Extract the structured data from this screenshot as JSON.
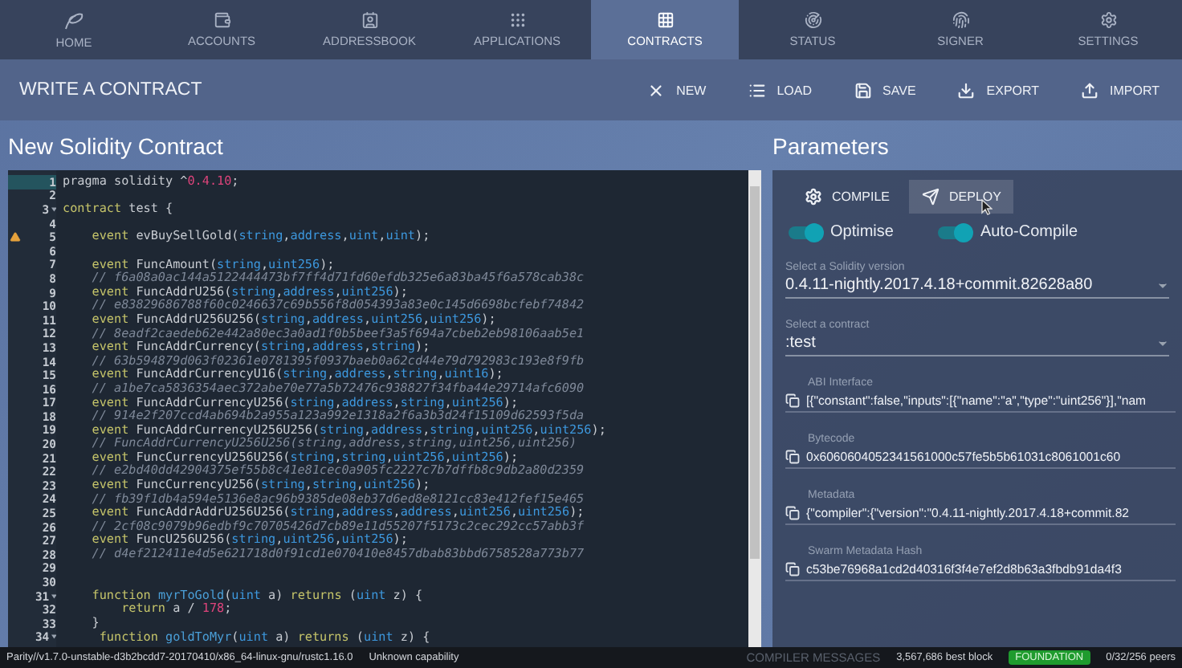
{
  "nav": {
    "tabs": [
      {
        "label": "HOME",
        "selected": false
      },
      {
        "label": "ACCOUNTS",
        "selected": false
      },
      {
        "label": "ADDRESSBOOK",
        "selected": false
      },
      {
        "label": "APPLICATIONS",
        "selected": false
      },
      {
        "label": "CONTRACTS",
        "selected": true
      },
      {
        "label": "STATUS",
        "selected": false
      },
      {
        "label": "SIGNER",
        "selected": false
      },
      {
        "label": "SETTINGS",
        "selected": false
      }
    ]
  },
  "toolbar": {
    "title": "WRITE A CONTRACT",
    "actions": [
      "NEW",
      "LOAD",
      "SAVE",
      "EXPORT",
      "IMPORT"
    ]
  },
  "editor": {
    "title": "New Solidity Contract",
    "lines": [
      {
        "number": "1",
        "current": true,
        "fold": false,
        "warning": false,
        "tokens": [
          {
            "kind": "plain",
            "text": "pragma solidity ^"
          },
          {
            "kind": "number",
            "text": "0.4.10"
          },
          {
            "kind": "plain",
            "text": ";"
          }
        ]
      },
      {
        "number": "2",
        "current": false,
        "fold": false,
        "warning": false
      },
      {
        "number": "3",
        "current": false,
        "fold": true,
        "warning": false,
        "tokens": [
          {
            "kind": "keyword",
            "text": "contract"
          },
          {
            "kind": "plain",
            "text": " test {"
          }
        ]
      },
      {
        "number": "4",
        "current": false,
        "fold": false,
        "warning": false
      },
      {
        "number": "5",
        "current": false,
        "fold": false,
        "warning": true,
        "tokens": [
          {
            "kind": "keyword",
            "text": "    event"
          },
          {
            "kind": "plain",
            "text": " evBuySellGold("
          },
          {
            "kind": "type",
            "text": "string"
          },
          {
            "kind": "plain",
            "text": ","
          },
          {
            "kind": "type",
            "text": "address"
          },
          {
            "kind": "plain",
            "text": ","
          },
          {
            "kind": "type",
            "text": "uint"
          },
          {
            "kind": "plain",
            "text": ","
          },
          {
            "kind": "type",
            "text": "uint"
          },
          {
            "kind": "plain",
            "text": ");"
          }
        ]
      },
      {
        "number": "6",
        "current": false,
        "fold": false,
        "warning": false
      },
      {
        "number": "7",
        "current": false,
        "fold": false,
        "warning": false,
        "tokens": [
          {
            "kind": "keyword",
            "text": "    event"
          },
          {
            "kind": "plain",
            "text": " FuncAmount("
          },
          {
            "kind": "type",
            "text": "string"
          },
          {
            "kind": "plain",
            "text": ","
          },
          {
            "kind": "type",
            "text": "uint256"
          },
          {
            "kind": "plain",
            "text": ");"
          }
        ]
      },
      {
        "number": "8",
        "current": false,
        "fold": false,
        "warning": false,
        "tokens": [
          {
            "kind": "comment",
            "text": "    // f6a08a0ac144a5122444473bf7ff4d71fd60efdb325e6a83ba45f6a578cab38c"
          }
        ]
      },
      {
        "number": "9",
        "current": false,
        "fold": false,
        "warning": false,
        "tokens": [
          {
            "kind": "keyword",
            "text": "    event"
          },
          {
            "kind": "plain",
            "text": " FuncAddrU256("
          },
          {
            "kind": "type",
            "text": "string"
          },
          {
            "kind": "plain",
            "text": ","
          },
          {
            "kind": "type",
            "text": "address"
          },
          {
            "kind": "plain",
            "text": ","
          },
          {
            "kind": "type",
            "text": "uint256"
          },
          {
            "kind": "plain",
            "text": ");"
          }
        ]
      },
      {
        "number": "10",
        "current": false,
        "fold": false,
        "warning": false,
        "tokens": [
          {
            "kind": "comment",
            "text": "    // e83829686788f60c0246637c69b556f8d054393a83e0c145d6698bcfebf74842"
          }
        ]
      },
      {
        "number": "11",
        "current": false,
        "fold": false,
        "warning": false,
        "tokens": [
          {
            "kind": "keyword",
            "text": "    event"
          },
          {
            "kind": "plain",
            "text": " FuncAddrU256U256("
          },
          {
            "kind": "type",
            "text": "string"
          },
          {
            "kind": "plain",
            "text": ","
          },
          {
            "kind": "type",
            "text": "address"
          },
          {
            "kind": "plain",
            "text": ","
          },
          {
            "kind": "type",
            "text": "uint256"
          },
          {
            "kind": "plain",
            "text": ","
          },
          {
            "kind": "type",
            "text": "uint256"
          },
          {
            "kind": "plain",
            "text": ");"
          }
        ]
      },
      {
        "number": "12",
        "current": false,
        "fold": false,
        "warning": false,
        "tokens": [
          {
            "kind": "comment",
            "text": "    // 8eadf2caedeb62e442a80ec3a0ad1f0b5beef3a5f694a7cbeb2eb98106aab5e1"
          }
        ]
      },
      {
        "number": "13",
        "current": false,
        "fold": false,
        "warning": false,
        "tokens": [
          {
            "kind": "keyword",
            "text": "    event"
          },
          {
            "kind": "plain",
            "text": " FuncAddrCurrency("
          },
          {
            "kind": "type",
            "text": "string"
          },
          {
            "kind": "plain",
            "text": ","
          },
          {
            "kind": "type",
            "text": "address"
          },
          {
            "kind": "plain",
            "text": ","
          },
          {
            "kind": "type",
            "text": "string"
          },
          {
            "kind": "plain",
            "text": ");"
          }
        ]
      },
      {
        "number": "14",
        "current": false,
        "fold": false,
        "warning": false,
        "tokens": [
          {
            "kind": "comment",
            "text": "    // 63b594879d063f02361e0781395f0937baeb0a62cd44e79d792983c193e8f9fb"
          }
        ]
      },
      {
        "number": "15",
        "current": false,
        "fold": false,
        "warning": false,
        "tokens": [
          {
            "kind": "keyword",
            "text": "    event"
          },
          {
            "kind": "plain",
            "text": " FuncAddrCurrencyU16("
          },
          {
            "kind": "type",
            "text": "string"
          },
          {
            "kind": "plain",
            "text": ","
          },
          {
            "kind": "type",
            "text": "address"
          },
          {
            "kind": "plain",
            "text": ","
          },
          {
            "kind": "type",
            "text": "string"
          },
          {
            "kind": "plain",
            "text": ","
          },
          {
            "kind": "type",
            "text": "uint16"
          },
          {
            "kind": "plain",
            "text": ");"
          }
        ]
      },
      {
        "number": "16",
        "current": false,
        "fold": false,
        "warning": false,
        "tokens": [
          {
            "kind": "comment",
            "text": "    // a1be7ca5836354aec372abe70e77a5b72476c938827f34fba44e29714afc6090"
          }
        ]
      },
      {
        "number": "17",
        "current": false,
        "fold": false,
        "warning": false,
        "tokens": [
          {
            "kind": "keyword",
            "text": "    event"
          },
          {
            "kind": "plain",
            "text": " FuncAddrCurrencyU256("
          },
          {
            "kind": "type",
            "text": "string"
          },
          {
            "kind": "plain",
            "text": ","
          },
          {
            "kind": "type",
            "text": "address"
          },
          {
            "kind": "plain",
            "text": ","
          },
          {
            "kind": "type",
            "text": "string"
          },
          {
            "kind": "plain",
            "text": ","
          },
          {
            "kind": "type",
            "text": "uint256"
          },
          {
            "kind": "plain",
            "text": ");"
          }
        ]
      },
      {
        "number": "18",
        "current": false,
        "fold": false,
        "warning": false,
        "tokens": [
          {
            "kind": "comment",
            "text": "    // 914e2f207ccd4ab694b2a955a123a992e1318a2f6a3b3d24f15109d62593f5da"
          }
        ]
      },
      {
        "number": "19",
        "current": false,
        "fold": false,
        "warning": false,
        "tokens": [
          {
            "kind": "keyword",
            "text": "    event"
          },
          {
            "kind": "plain",
            "text": " FuncAddrCurrencyU256U256("
          },
          {
            "kind": "type",
            "text": "string"
          },
          {
            "kind": "plain",
            "text": ","
          },
          {
            "kind": "type",
            "text": "address"
          },
          {
            "kind": "plain",
            "text": ","
          },
          {
            "kind": "type",
            "text": "string"
          },
          {
            "kind": "plain",
            "text": ","
          },
          {
            "kind": "type",
            "text": "uint256"
          },
          {
            "kind": "plain",
            "text": ","
          },
          {
            "kind": "type",
            "text": "uint256"
          },
          {
            "kind": "plain",
            "text": ");"
          }
        ]
      },
      {
        "number": "20",
        "current": false,
        "fold": false,
        "warning": false,
        "tokens": [
          {
            "kind": "comment",
            "text": "    // FuncAddrCurrencyU256U256(string,address,string,uint256,uint256)"
          }
        ]
      },
      {
        "number": "21",
        "current": false,
        "fold": false,
        "warning": false,
        "tokens": [
          {
            "kind": "keyword",
            "text": "    event"
          },
          {
            "kind": "plain",
            "text": " FuncCurrencyU256U256("
          },
          {
            "kind": "type",
            "text": "string"
          },
          {
            "kind": "plain",
            "text": ","
          },
          {
            "kind": "type",
            "text": "string"
          },
          {
            "kind": "plain",
            "text": ","
          },
          {
            "kind": "type",
            "text": "uint256"
          },
          {
            "kind": "plain",
            "text": ","
          },
          {
            "kind": "type",
            "text": "uint256"
          },
          {
            "kind": "plain",
            "text": ");"
          }
        ]
      },
      {
        "number": "22",
        "current": false,
        "fold": false,
        "warning": false,
        "tokens": [
          {
            "kind": "comment",
            "text": "    // e2bd40dd42904375ef55b8c41e81cec0a905fc2227c7b7dffb8c9db2a80d2359"
          }
        ]
      },
      {
        "number": "23",
        "current": false,
        "fold": false,
        "warning": false,
        "tokens": [
          {
            "kind": "keyword",
            "text": "    event"
          },
          {
            "kind": "plain",
            "text": " FuncCurrencyU256("
          },
          {
            "kind": "type",
            "text": "string"
          },
          {
            "kind": "plain",
            "text": ","
          },
          {
            "kind": "type",
            "text": "string"
          },
          {
            "kind": "plain",
            "text": ","
          },
          {
            "kind": "type",
            "text": "uint256"
          },
          {
            "kind": "plain",
            "text": ");"
          }
        ]
      },
      {
        "number": "24",
        "current": false,
        "fold": false,
        "warning": false,
        "tokens": [
          {
            "kind": "comment",
            "text": "    // fb39f1db4a594e5136e8ac96b9385de08eb37d6ed8e8121cc83e412fef15e465"
          }
        ]
      },
      {
        "number": "25",
        "current": false,
        "fold": false,
        "warning": false,
        "tokens": [
          {
            "kind": "keyword",
            "text": "    event"
          },
          {
            "kind": "plain",
            "text": " FuncAddrAddrU256U256("
          },
          {
            "kind": "type",
            "text": "string"
          },
          {
            "kind": "plain",
            "text": ","
          },
          {
            "kind": "type",
            "text": "address"
          },
          {
            "kind": "plain",
            "text": ","
          },
          {
            "kind": "type",
            "text": "address"
          },
          {
            "kind": "plain",
            "text": ","
          },
          {
            "kind": "type",
            "text": "uint256"
          },
          {
            "kind": "plain",
            "text": ","
          },
          {
            "kind": "type",
            "text": "uint256"
          },
          {
            "kind": "plain",
            "text": ");"
          }
        ]
      },
      {
        "number": "26",
        "current": false,
        "fold": false,
        "warning": false,
        "tokens": [
          {
            "kind": "comment",
            "text": "    // 2cf08c9079b96edbf9c70705426d7cb89e11d55207f5173c2cec292cc57abb3f"
          }
        ]
      },
      {
        "number": "27",
        "current": false,
        "fold": false,
        "warning": false,
        "tokens": [
          {
            "kind": "keyword",
            "text": "    event"
          },
          {
            "kind": "plain",
            "text": " FuncU256U256("
          },
          {
            "kind": "type",
            "text": "string"
          },
          {
            "kind": "plain",
            "text": ","
          },
          {
            "kind": "type",
            "text": "uint256"
          },
          {
            "kind": "plain",
            "text": ","
          },
          {
            "kind": "type",
            "text": "uint256"
          },
          {
            "kind": "plain",
            "text": ");"
          }
        ]
      },
      {
        "number": "28",
        "current": false,
        "fold": false,
        "warning": false,
        "tokens": [
          {
            "kind": "comment",
            "text": "    // d4ef212411e4d5e621718d0f91cd1e070410e8457dbab83bbd6758528a773b77"
          }
        ]
      },
      {
        "number": "29",
        "current": false,
        "fold": false,
        "warning": false
      },
      {
        "number": "30",
        "current": false,
        "fold": false,
        "warning": false
      },
      {
        "number": "31",
        "current": false,
        "fold": true,
        "warning": false,
        "tokens": [
          {
            "kind": "keyword",
            "text": "    function"
          },
          {
            "kind": "name",
            "text": " myrToGold"
          },
          {
            "kind": "plain",
            "text": "("
          },
          {
            "kind": "type",
            "text": "uint"
          },
          {
            "kind": "plain",
            "text": " a) "
          },
          {
            "kind": "keyword",
            "text": "returns"
          },
          {
            "kind": "plain",
            "text": " ("
          },
          {
            "kind": "type",
            "text": "uint"
          },
          {
            "kind": "plain",
            "text": " z) {"
          }
        ]
      },
      {
        "number": "32",
        "current": false,
        "fold": false,
        "warning": false,
        "tokens": [
          {
            "kind": "keyword",
            "text": "        return"
          },
          {
            "kind": "plain",
            "text": " a / "
          },
          {
            "kind": "number",
            "text": "178"
          },
          {
            "kind": "plain",
            "text": ";"
          }
        ]
      },
      {
        "number": "33",
        "current": false,
        "fold": false,
        "warning": false,
        "tokens": [
          {
            "kind": "plain",
            "text": "    }"
          }
        ]
      },
      {
        "number": "34",
        "current": false,
        "fold": true,
        "warning": false,
        "tokens": [
          {
            "kind": "keyword",
            "text": "     function"
          },
          {
            "kind": "name",
            "text": " goldToMyr"
          },
          {
            "kind": "plain",
            "text": "("
          },
          {
            "kind": "type",
            "text": "uint"
          },
          {
            "kind": "plain",
            "text": " a) "
          },
          {
            "kind": "keyword",
            "text": "returns"
          },
          {
            "kind": "plain",
            "text": " ("
          },
          {
            "kind": "type",
            "text": "uint"
          },
          {
            "kind": "plain",
            "text": " z) {"
          }
        ]
      }
    ]
  },
  "parameters": {
    "title": "Parameters",
    "buttons": [
      {
        "label": "COMPILE",
        "kind": "compile",
        "hovered": false
      },
      {
        "label": "DEPLOY",
        "kind": "deploy",
        "hovered": true
      }
    ],
    "toggles": [
      {
        "label": "Optimise",
        "on": true
      },
      {
        "label": "Auto-Compile",
        "on": true
      }
    ],
    "selects": [
      {
        "label": "Select a Solidity version",
        "value": "0.4.11-nightly.2017.4.18+commit.82628a80"
      },
      {
        "label": "Select a contract",
        "value": ":test"
      }
    ],
    "outputs": [
      {
        "label": "ABI Interface",
        "value": "[{\"constant\":false,\"inputs\":[{\"name\":\"a\",\"type\":\"uint256\"}],\"nam"
      },
      {
        "label": "Bytecode",
        "value": "0x6060604052341561000c57fe5b5b61031c8061001c60"
      },
      {
        "label": "Metadata",
        "value": "{\"compiler\":{\"version\":\"0.4.11-nightly.2017.4.18+commit.82"
      },
      {
        "label": "Swarm Metadata Hash",
        "value": "c53be76968a1cd2d40316f3f4e7ef2d8b63a3fbdb91da4f3"
      }
    ],
    "messages_heading": "COMPILER MESSAGES"
  },
  "status_bar": {
    "version": "Parity//v1.7.0-unstable-d3b2bcdd7-20170410/x86_64-linux-gnu/rustc1.16.0",
    "capability": "Unknown capability",
    "block": "3,567,686 best block",
    "chain": "FOUNDATION",
    "peers": "0/32/256 peers"
  }
}
